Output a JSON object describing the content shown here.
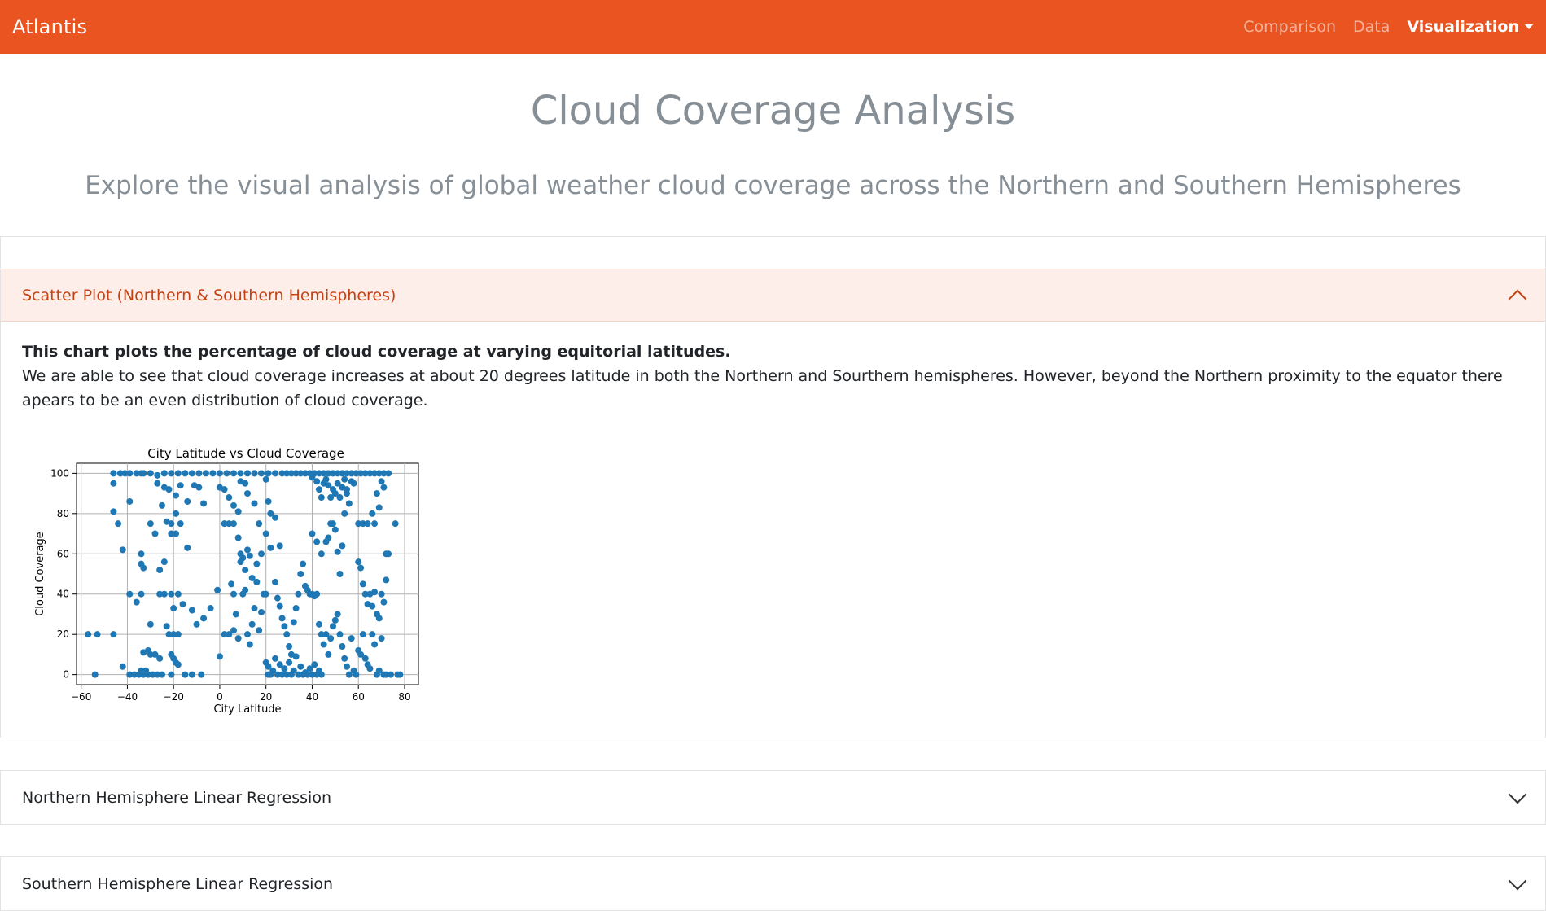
{
  "navbar": {
    "brand": "Atlantis",
    "links": [
      {
        "label": "Comparison"
      },
      {
        "label": "Data"
      },
      {
        "label": "Visualization"
      }
    ]
  },
  "page": {
    "title": "Cloud Coverage Analysis",
    "subtitle": "Explore the visual analysis of global weather cloud coverage across the Northern and Southern Hemispheres"
  },
  "accordion": [
    {
      "header": "Scatter Plot (Northern & Southern Hemispheres)",
      "expanded": true,
      "body_bold": "This chart plots the percentage of cloud coverage at varying equitorial latitudes.",
      "body_text": "We are able to see that cloud coverage increases at about 20 degrees latitude in both the Northern and Sourthern hemispheres. However, beyond the Northern proximity to the equator there apears to be an even distribution of cloud coverage."
    },
    {
      "header": "Northern Hemisphere Linear Regression",
      "expanded": false
    },
    {
      "header": "Southern Hemisphere Linear Regression",
      "expanded": false
    }
  ],
  "colors": {
    "navbar": "#e95420",
    "accent_text": "#c34113",
    "point": "#1f77b4"
  },
  "chart_data": {
    "type": "scatter",
    "title": "City Latitude vs Cloud Coverage",
    "xlabel": "City Latitude",
    "ylabel": "Cloud Coverage",
    "xlim": [
      -62,
      86
    ],
    "ylim": [
      -5,
      105
    ],
    "xticks": [
      -60,
      -40,
      -20,
      0,
      20,
      40,
      60,
      80
    ],
    "xtick_labels": [
      "−60",
      "−40",
      "−20",
      "0",
      "20",
      "40",
      "60",
      "80"
    ],
    "yticks": [
      0,
      20,
      40,
      60,
      80,
      100
    ],
    "ytick_labels": [
      "0",
      "20",
      "40",
      "60",
      "80",
      "100"
    ],
    "grid": true,
    "points": [
      [
        -54,
        0
      ],
      [
        -57,
        20
      ],
      [
        -53,
        20
      ],
      [
        -46,
        20
      ],
      [
        -46,
        95
      ],
      [
        -46,
        81
      ],
      [
        -44,
        75
      ],
      [
        -42,
        62
      ],
      [
        -42,
        4
      ],
      [
        -39,
        86
      ],
      [
        -39,
        40
      ],
      [
        -46,
        100
      ],
      [
        -43,
        100
      ],
      [
        -41,
        100
      ],
      [
        -39,
        100
      ],
      [
        -36,
        100
      ],
      [
        -34,
        100
      ],
      [
        -33,
        100
      ],
      [
        -30,
        100
      ],
      [
        -27,
        99
      ],
      [
        -24,
        100
      ],
      [
        -21,
        100
      ],
      [
        -18,
        100
      ],
      [
        -15,
        100
      ],
      [
        -12,
        100
      ],
      [
        -9,
        100
      ],
      [
        -6,
        100
      ],
      [
        -3,
        100
      ],
      [
        0,
        100
      ],
      [
        3,
        100
      ],
      [
        6,
        100
      ],
      [
        9,
        100
      ],
      [
        12,
        100
      ],
      [
        15,
        100
      ],
      [
        18,
        100
      ],
      [
        21,
        100
      ],
      [
        24,
        100
      ],
      [
        27,
        100
      ],
      [
        29,
        100
      ],
      [
        31,
        100
      ],
      [
        33,
        100
      ],
      [
        35,
        100
      ],
      [
        37,
        100
      ],
      [
        39,
        100
      ],
      [
        41,
        100
      ],
      [
        43,
        100
      ],
      [
        45,
        100
      ],
      [
        47,
        100
      ],
      [
        49,
        100
      ],
      [
        51,
        100
      ],
      [
        53,
        100
      ],
      [
        55,
        100
      ],
      [
        57,
        100
      ],
      [
        59,
        100
      ],
      [
        61,
        100
      ],
      [
        63,
        100
      ],
      [
        65,
        100
      ],
      [
        67,
        100
      ],
      [
        69,
        100
      ],
      [
        71,
        100
      ],
      [
        73,
        100
      ],
      [
        -39,
        0
      ],
      [
        -37,
        0
      ],
      [
        -35,
        0
      ],
      [
        -33,
        0
      ],
      [
        -31,
        0
      ],
      [
        -29,
        0
      ],
      [
        -27,
        0
      ],
      [
        -25,
        0
      ],
      [
        -34,
        2
      ],
      [
        -32,
        2
      ],
      [
        -30,
        10
      ],
      [
        -28,
        10
      ],
      [
        -26,
        8
      ],
      [
        -31,
        12
      ],
      [
        -33,
        11
      ],
      [
        -21,
        0
      ],
      [
        -18,
        5
      ],
      [
        -15,
        0
      ],
      [
        -12,
        0
      ],
      [
        -8,
        0
      ],
      [
        -21,
        10
      ],
      [
        -20,
        8
      ],
      [
        -19,
        6
      ],
      [
        -22,
        20
      ],
      [
        -20,
        20
      ],
      [
        -18,
        20
      ],
      [
        -23,
        24
      ],
      [
        -36,
        36
      ],
      [
        -34,
        40
      ],
      [
        -30,
        25
      ],
      [
        -26,
        40
      ],
      [
        -24,
        40
      ],
      [
        -21,
        40
      ],
      [
        -20,
        33
      ],
      [
        -18,
        40
      ],
      [
        -16,
        35
      ],
      [
        -12,
        32
      ],
      [
        -10,
        25
      ],
      [
        -7,
        28
      ],
      [
        -4,
        33
      ],
      [
        -1,
        42
      ],
      [
        -34,
        55
      ],
      [
        -33,
        53
      ],
      [
        -26,
        52
      ],
      [
        -24,
        56
      ],
      [
        -21,
        70
      ],
      [
        -19,
        70
      ],
      [
        -17,
        75
      ],
      [
        -14,
        63
      ],
      [
        -34,
        60
      ],
      [
        -30,
        75
      ],
      [
        -28,
        70
      ],
      [
        -24,
        93
      ],
      [
        -22,
        92
      ],
      [
        -19,
        89
      ],
      [
        -17,
        94
      ],
      [
        -14,
        86
      ],
      [
        -11,
        94
      ],
      [
        -9,
        93
      ],
      [
        -7,
        85
      ],
      [
        -27,
        95
      ],
      [
        -25,
        84
      ],
      [
        -23,
        76
      ],
      [
        -21,
        75
      ],
      [
        -19,
        80
      ],
      [
        0,
        9
      ],
      [
        2,
        20
      ],
      [
        4,
        20
      ],
      [
        5,
        45
      ],
      [
        6,
        40
      ],
      [
        6,
        22
      ],
      [
        7,
        30
      ],
      [
        8,
        18
      ],
      [
        9,
        56
      ],
      [
        10,
        40
      ],
      [
        11,
        42
      ],
      [
        12,
        20
      ],
      [
        13,
        15
      ],
      [
        14,
        25
      ],
      [
        15,
        33
      ],
      [
        16,
        46
      ],
      [
        17,
        22
      ],
      [
        18,
        31
      ],
      [
        19,
        40
      ],
      [
        20,
        40
      ],
      [
        20,
        6
      ],
      [
        21,
        4
      ],
      [
        21,
        0
      ],
      [
        22,
        0
      ],
      [
        23,
        2
      ],
      [
        24,
        8
      ],
      [
        25,
        0
      ],
      [
        26,
        5
      ],
      [
        27,
        0
      ],
      [
        28,
        3
      ],
      [
        29,
        0
      ],
      [
        30,
        6
      ],
      [
        31,
        0
      ],
      [
        32,
        2
      ],
      [
        33,
        9
      ],
      [
        34,
        0
      ],
      [
        35,
        4
      ],
      [
        36,
        0
      ],
      [
        37,
        1
      ],
      [
        38,
        0
      ],
      [
        39,
        3
      ],
      [
        40,
        0
      ],
      [
        41,
        5
      ],
      [
        42,
        0
      ],
      [
        43,
        2
      ],
      [
        44,
        0
      ],
      [
        2,
        75
      ],
      [
        4,
        75
      ],
      [
        6,
        75
      ],
      [
        8,
        68
      ],
      [
        9,
        60
      ],
      [
        10,
        58
      ],
      [
        11,
        52
      ],
      [
        12,
        62
      ],
      [
        13,
        59
      ],
      [
        14,
        48
      ],
      [
        16,
        55
      ],
      [
        18,
        60
      ],
      [
        20,
        70
      ],
      [
        22,
        63
      ],
      [
        24,
        78
      ],
      [
        26,
        64
      ],
      [
        0,
        93
      ],
      [
        2,
        92
      ],
      [
        4,
        88
      ],
      [
        6,
        84
      ],
      [
        8,
        81
      ],
      [
        9,
        96
      ],
      [
        11,
        95
      ],
      [
        12,
        90
      ],
      [
        15,
        85
      ],
      [
        17,
        75
      ],
      [
        20,
        97
      ],
      [
        21,
        86
      ],
      [
        22,
        80
      ],
      [
        24,
        46
      ],
      [
        25,
        38
      ],
      [
        26,
        34
      ],
      [
        27,
        28
      ],
      [
        28,
        24
      ],
      [
        29,
        20
      ],
      [
        30,
        14
      ],
      [
        31,
        10
      ],
      [
        32,
        26
      ],
      [
        33,
        33
      ],
      [
        34,
        40
      ],
      [
        35,
        50
      ],
      [
        36,
        55
      ],
      [
        37,
        44
      ],
      [
        38,
        42
      ],
      [
        39,
        40
      ],
      [
        40,
        40
      ],
      [
        41,
        39
      ],
      [
        42,
        40
      ],
      [
        43,
        25
      ],
      [
        44,
        20
      ],
      [
        45,
        15
      ],
      [
        46,
        20
      ],
      [
        47,
        10
      ],
      [
        48,
        18
      ],
      [
        49,
        24
      ],
      [
        50,
        27
      ],
      [
        51,
        30
      ],
      [
        52,
        20
      ],
      [
        53,
        14
      ],
      [
        54,
        8
      ],
      [
        55,
        4
      ],
      [
        56,
        0
      ],
      [
        57,
        18
      ],
      [
        58,
        2
      ],
      [
        59,
        0
      ],
      [
        40,
        70
      ],
      [
        42,
        66
      ],
      [
        44,
        60
      ],
      [
        46,
        66
      ],
      [
        47,
        68
      ],
      [
        48,
        75
      ],
      [
        49,
        75
      ],
      [
        50,
        72
      ],
      [
        51,
        61
      ],
      [
        52,
        50
      ],
      [
        53,
        64
      ],
      [
        54,
        80
      ],
      [
        55,
        90
      ],
      [
        56,
        85
      ],
      [
        40,
        98
      ],
      [
        42,
        96
      ],
      [
        43,
        92
      ],
      [
        44,
        88
      ],
      [
        45,
        95
      ],
      [
        46,
        97
      ],
      [
        47,
        94
      ],
      [
        48,
        88
      ],
      [
        49,
        92
      ],
      [
        50,
        90
      ],
      [
        51,
        95
      ],
      [
        52,
        88
      ],
      [
        53,
        93
      ],
      [
        54,
        97
      ],
      [
        55,
        92
      ],
      [
        57,
        96
      ],
      [
        58,
        95
      ],
      [
        60,
        56
      ],
      [
        61,
        53
      ],
      [
        62,
        45
      ],
      [
        63,
        40
      ],
      [
        64,
        35
      ],
      [
        65,
        40
      ],
      [
        66,
        34
      ],
      [
        67,
        41
      ],
      [
        68,
        30
      ],
      [
        69,
        28
      ],
      [
        70,
        40
      ],
      [
        71,
        36
      ],
      [
        72,
        47
      ],
      [
        73,
        60
      ],
      [
        60,
        12
      ],
      [
        61,
        10
      ],
      [
        62,
        20
      ],
      [
        63,
        8
      ],
      [
        64,
        5
      ],
      [
        65,
        3
      ],
      [
        66,
        20
      ],
      [
        67,
        15
      ],
      [
        68,
        0
      ],
      [
        69,
        2
      ],
      [
        70,
        18
      ],
      [
        71,
        0
      ],
      [
        72,
        0
      ],
      [
        74,
        0
      ],
      [
        77,
        0
      ],
      [
        60,
        75
      ],
      [
        62,
        75
      ],
      [
        64,
        75
      ],
      [
        66,
        80
      ],
      [
        67,
        75
      ],
      [
        68,
        90
      ],
      [
        69,
        83
      ],
      [
        70,
        96
      ],
      [
        71,
        93
      ],
      [
        72,
        60
      ],
      [
        76,
        75
      ],
      [
        78,
        0
      ]
    ]
  }
}
